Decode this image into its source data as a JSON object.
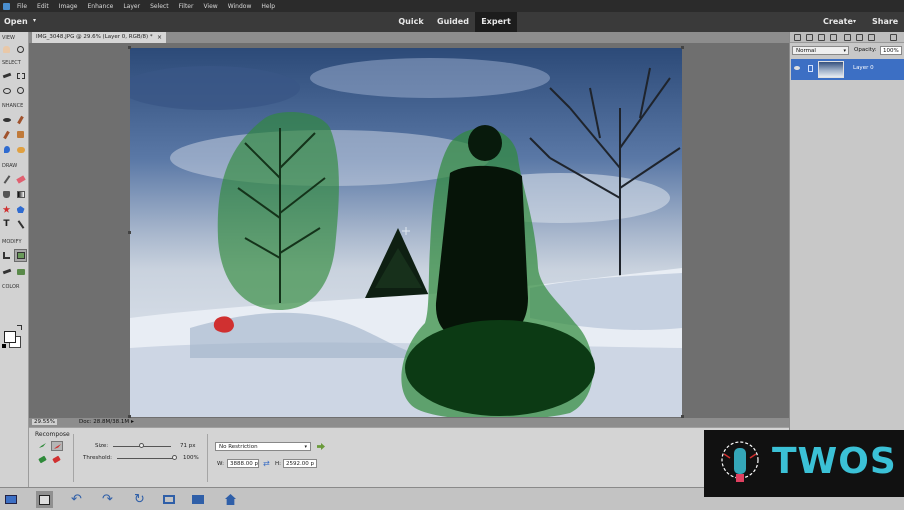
{
  "menubar": {
    "items": [
      "File",
      "Edit",
      "Image",
      "Enhance",
      "Layer",
      "Select",
      "Filter",
      "View",
      "Window",
      "Help"
    ]
  },
  "modebar": {
    "open_label": "Open",
    "modes": [
      {
        "label": "Quick",
        "active": false
      },
      {
        "label": "Guided",
        "active": false
      },
      {
        "label": "Expert",
        "active": true
      }
    ],
    "create_label": "Create",
    "share_label": "Share"
  },
  "toolbox": {
    "sections": [
      "VIEW",
      "SELECT",
      "NHANCE",
      "DRAW",
      "MODIFY",
      "COLOR"
    ],
    "active_tool": "recompose-tool",
    "foreground_color": "#ffffff",
    "background_color": "#ffffff"
  },
  "document": {
    "tab_title": "IMG_3048.JPG @ 29.6% (Layer 0, RGB/8) *",
    "close_glyph": "×"
  },
  "statusbar": {
    "zoom": "29.55%",
    "doc_info": "Doc: 28.8M/38.1M",
    "menu_arrow": "▸"
  },
  "layers_panel": {
    "blend_mode": "Normal",
    "opacity_label": "Opacity:",
    "opacity_value": "100%",
    "layers": [
      {
        "name": "Layer 0",
        "visible": true,
        "selected": true
      }
    ]
  },
  "tool_options": {
    "title": "Recompose",
    "size_label": "Size:",
    "size_value": "71 px",
    "size_level": 0.5,
    "threshold_label": "Threshold:",
    "threshold_value": "100%",
    "threshold_level": 1.0,
    "restriction": "No Restriction",
    "width_label": "W:",
    "width_value": "3888.00 p",
    "height_label": "H:",
    "height_value": "2592.00 p",
    "colors": {
      "protect": "#2f8a3a",
      "remove": "#d03030"
    }
  },
  "bottombar": {
    "buttons": [
      "photo-bin-icon",
      "tool-options-icon",
      "undo-icon",
      "redo-icon",
      "rotate-icon",
      "layout-icon",
      "organizer-icon",
      "home-screen-icon"
    ],
    "active": "tool-options-icon"
  },
  "watermark": {
    "text": "TWOS"
  },
  "colors": {
    "accent_blue": "#3c6fc4",
    "protect_green": "#2f8a3a",
    "remove_red": "#d03030"
  }
}
